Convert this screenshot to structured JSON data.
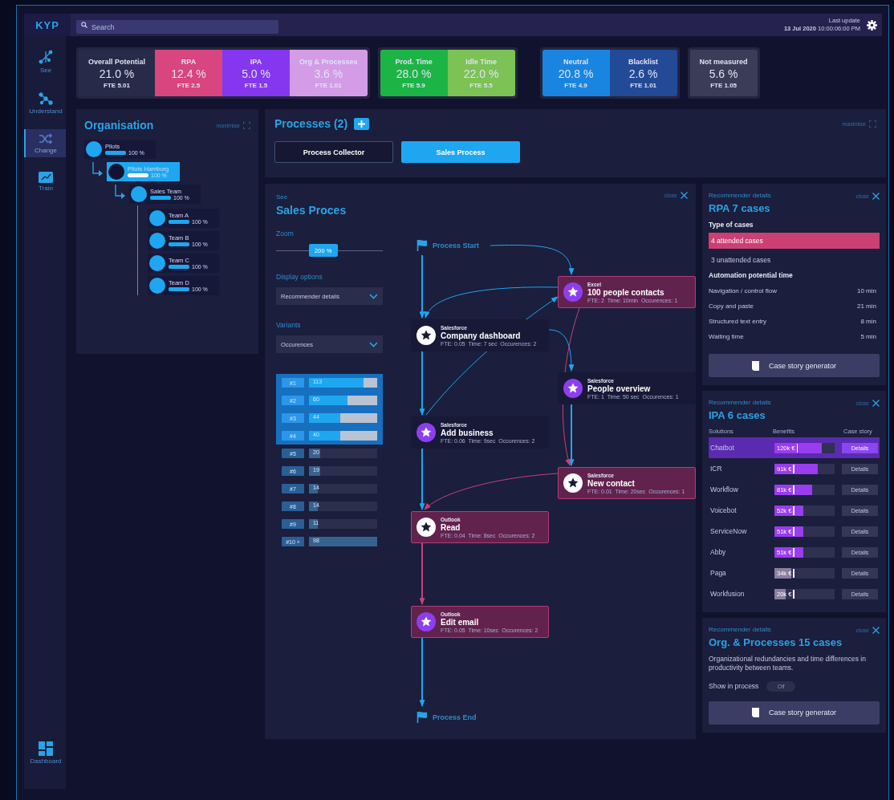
{
  "topbar": {
    "logo": "KYP",
    "search": {
      "placeholder": "Search"
    },
    "last_update_label": "Last update",
    "last_update": "**13 Jul 2020** 10:00:06:00 PM"
  },
  "sidebar": {
    "items": [
      {
        "label": "See",
        "kind": "network",
        "selected": false
      },
      {
        "label": "Understand",
        "kind": "nodes",
        "selected": false
      },
      {
        "label": "Change",
        "kind": "shuffle",
        "selected": true
      },
      {
        "label": "Train",
        "kind": "chart",
        "selected": false
      },
      {
        "label": "Dashboard",
        "kind": "grid",
        "selected": false
      }
    ]
  },
  "kpi_groups": [
    {
      "tiles": [
        {
          "label": "Overall Potential",
          "value": "21.0 %",
          "fte": "FTE 5.01",
          "color": "#272a48"
        },
        {
          "label": "RPA",
          "value": "12.4 %",
          "fte": "FTE 2.5",
          "color": "#d8457f"
        },
        {
          "label": "IPA",
          "value": "5.0 %",
          "fte": "FTE 1.5",
          "color": "#8437ee"
        },
        {
          "label": "Org & Processes",
          "value": "3.6 %",
          "fte": "FTE 1.01",
          "color": "#d49ce6"
        }
      ]
    },
    {
      "tiles": [
        {
          "label": "Prod. Time",
          "value": "28.0 %",
          "fte": "FTE 5.9",
          "color": "#1db446"
        },
        {
          "label": "Idle Time",
          "value": "22.0 %",
          "fte": "FTE 5.5",
          "color": "#7cc255"
        }
      ]
    },
    {
      "tiles": [
        {
          "label": "Neutral",
          "value": "20.8 %",
          "fte": "FTE 4.9",
          "color": "#1985e0"
        },
        {
          "label": "Blacklist",
          "value": "2.6 %",
          "fte": "FTE 1.01",
          "color": "#224a96"
        }
      ]
    },
    {
      "tiles": [
        {
          "label": "Not measured",
          "value": "5.6 %",
          "fte": "FTE 1.05",
          "color": "#3a3c58"
        }
      ]
    }
  ],
  "organisation": {
    "title": "Organisation",
    "maximise": "maximise",
    "tree": [
      {
        "name": "Pilots",
        "level": 1,
        "reading": "100 %",
        "selected": false,
        "children": [
          {
            "name": "Pilots Hamburg",
            "level": 1,
            "reading": "100 %",
            "selected": true,
            "children": [
              {
                "name": "Sales Team",
                "level": 1,
                "reading": "100 %",
                "selected": false,
                "children": [
                  {
                    "name": "Team A",
                    "level": 1,
                    "reading": "100 %",
                    "selected": false
                  },
                  {
                    "name": "Team B",
                    "level": 1,
                    "reading": "100 %",
                    "selected": false
                  },
                  {
                    "name": "Team C",
                    "level": 1,
                    "reading": "100 %",
                    "selected": false
                  },
                  {
                    "name": "Team D",
                    "level": 1,
                    "reading": "100 %",
                    "selected": false
                  }
                ]
              }
            ]
          }
        ]
      }
    ]
  },
  "processes": {
    "title": "Processes (2)",
    "maximise": "maximise",
    "tabs": [
      {
        "label": "Process Collector",
        "selected": false
      },
      {
        "label": "Sales Process",
        "selected": true
      }
    ]
  },
  "process_view": {
    "kicker": "See",
    "title": "Sales Proces",
    "close": "close",
    "zoom": {
      "label": "Zoom",
      "level": 0.42,
      "reading": "200 %"
    },
    "display_options": {
      "label": "Display options",
      "value": "Recommender details"
    },
    "variants": {
      "label": "Variants",
      "value": "Occurences",
      "items": [
        {
          "rank": "#1",
          "count": "113",
          "level": 0.8,
          "selected": true
        },
        {
          "rank": "#2",
          "count": "60",
          "level": 0.56,
          "selected": true
        },
        {
          "rank": "#3",
          "count": "44",
          "level": 0.46,
          "selected": true
        },
        {
          "rank": "#4",
          "count": "40",
          "level": 0.46,
          "selected": true
        },
        {
          "rank": "#5",
          "count": "20",
          "level": 0.17,
          "selected": false
        },
        {
          "rank": "#6",
          "count": "19",
          "level": 0.17,
          "selected": false
        },
        {
          "rank": "#7",
          "count": "14",
          "level": 0.13,
          "selected": false
        },
        {
          "rank": "#8",
          "count": "14",
          "level": 0.13,
          "selected": false
        },
        {
          "rank": "#9",
          "count": "11",
          "level": 0.13,
          "selected": false
        },
        {
          "rank": "#10 +",
          "count": "98",
          "level": 1,
          "selected": false
        }
      ]
    },
    "flow": {
      "start": "Process Start",
      "end": "Process End",
      "nodes": [
        {
          "app": "Excel",
          "name": "100 people contacts",
          "stats": "FTE: 2  Time: 10min  Occurences: 1",
          "kind": "filled",
          "highlighted": true
        },
        {
          "app": "Salesforce",
          "name": "Company dashboard",
          "stats": "FTE: 0.05  Time: 7 sec  Occurences: 2",
          "kind": "plain",
          "highlighted": false
        },
        {
          "app": "Salesforce",
          "name": "People overview",
          "stats": "FTE: 1  Time: 50 sec  Occurences: 1",
          "kind": "filled",
          "highlighted": false
        },
        {
          "app": "Salesforce",
          "name": "Add business",
          "stats": "FTE: 0.06  Time: 9sec  Occurences: 2",
          "kind": "filled",
          "highlighted": false
        },
        {
          "app": "Salesforce",
          "name": "New contact",
          "stats": "FTE: 0.01  Time: 20sec  Occurences: 1",
          "kind": "plain",
          "highlighted": true
        },
        {
          "app": "Outlook",
          "name": "Read",
          "stats": "FTE: 0.04  Time: 8sec  Occurences: 2",
          "kind": "plain",
          "highlighted": true
        },
        {
          "app": "Outlook",
          "name": "Edit email",
          "stats": "FTE: 0.05  Time: 10sec  Occurences: 2",
          "kind": "filled",
          "highlighted": true
        }
      ]
    }
  },
  "rpa": {
    "kicker": "Recommender details",
    "close": "close",
    "title": "RPA 7 cases",
    "type_heading": "Type of cases",
    "types": [
      {
        "label": "4 attended cases",
        "selected": true
      },
      {
        "label": "3 unattended cases",
        "selected": false
      }
    ],
    "time_heading": "Automation potential time",
    "times": [
      {
        "label": "Navigation / control flow",
        "value": "10 min"
      },
      {
        "label": "Copy and paste",
        "value": "21 min"
      },
      {
        "label": "Structured text entry",
        "value": "8 min"
      },
      {
        "label": "Waiting time",
        "value": "5 min"
      }
    ],
    "button": "Case story generator"
  },
  "ipa": {
    "kicker": "Recommender details",
    "close": "close",
    "title": "IPA 6 cases",
    "columns": [
      "Solutions",
      "Benefits",
      "Case story"
    ],
    "rows": [
      {
        "name": "Chatbot",
        "benefit": "120k €",
        "level": 0.78,
        "color": "#9a3cf0",
        "selected": true,
        "action": "Details"
      },
      {
        "name": "ICR",
        "benefit": "91k €",
        "level": 0.72,
        "color": "#9a3cf0",
        "selected": false,
        "action": "Details"
      },
      {
        "name": "Workflow",
        "benefit": "81k €",
        "level": 0.63,
        "color": "#9a3cf0",
        "selected": false,
        "action": "Details"
      },
      {
        "name": "Voicebot",
        "benefit": "52k €",
        "level": 0.48,
        "color": "#9a3cf0",
        "selected": false,
        "action": "Details"
      },
      {
        "name": "ServiceNow",
        "benefit": "51k €",
        "level": 0.48,
        "color": "#9a3cf0",
        "selected": false,
        "action": "Details"
      },
      {
        "name": "Abby",
        "benefit": "51k €",
        "level": 0.48,
        "color": "#9a3cf0",
        "selected": false,
        "action": "Details"
      },
      {
        "name": "Paga",
        "benefit": "34k €",
        "level": 0.28,
        "color": "#8a7fa0",
        "selected": false,
        "action": "Details"
      },
      {
        "name": "Workfusion",
        "benefit": "20k €",
        "level": 0.18,
        "color": "#8a7fa0",
        "selected": false,
        "action": "Details"
      }
    ]
  },
  "org_processes": {
    "kicker": "Recommender details",
    "close": "close",
    "title": "Org. & Processes 15 cases",
    "text": "Organizational redundancies and time differences in productivity between teams.",
    "toggle": {
      "label": "Show in process",
      "on": false,
      "state_text": "Off"
    },
    "button": "Case story generator"
  }
}
